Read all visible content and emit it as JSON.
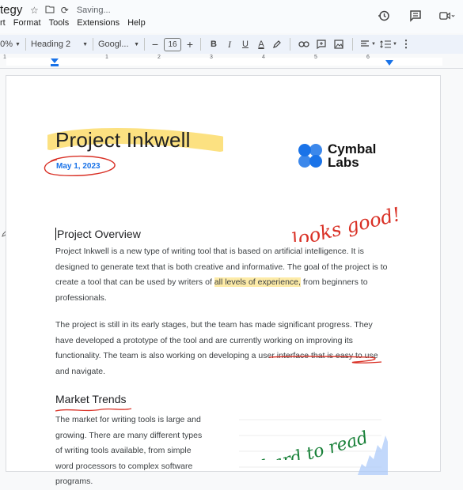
{
  "header": {
    "doc_title": "tegy",
    "saving_label": "Saving...",
    "menu": [
      "rt",
      "Format",
      "Tools",
      "Extensions",
      "Help"
    ]
  },
  "toolbar": {
    "zoom": "0%",
    "style": "Heading 2",
    "font": "Googl...",
    "font_size": "16",
    "bold": "B",
    "italic": "I",
    "underline": "U",
    "text_color": "A"
  },
  "ruler": {
    "numbers": [
      "1",
      "1",
      "2",
      "3",
      "4",
      "5",
      "6"
    ]
  },
  "document": {
    "title": "Project Inkwell",
    "date": "May 1, 2023",
    "logo_line1": "Cymbal",
    "logo_line2": "Labs",
    "overview_heading": "Project Overview",
    "para1_a": "Project Inkwell is a new type of writing tool that is based on artificial intelligence. It is designed to generate text that is both creative and informative. The goal of the project is to create a tool that can be used by writers of ",
    "para1_hl": "all levels of experience,",
    "para1_b": " from beginners to professionals.",
    "para2_a": "The project is still in its early stages, but the team has made significant progress. They have developed a prototype of the tool and are currently working on improving its functionality. The team is also working on developing a user interface that is ",
    "para2_u": "easy to use and navigate.",
    "market_heading": "Market Trends",
    "para3": "The market for writing tools is large and growing. There are many different types of writing tools available, from simple word processors to complex software programs."
  },
  "annotations": {
    "looks_good": "looks good!",
    "hard_to_read": "hard to read"
  },
  "colors": {
    "highlight": "#fbda61",
    "ink_red": "#d93025",
    "ink_green": "#188038",
    "date_blue": "#1a73e8",
    "logo_blue": "#1a73e8"
  }
}
